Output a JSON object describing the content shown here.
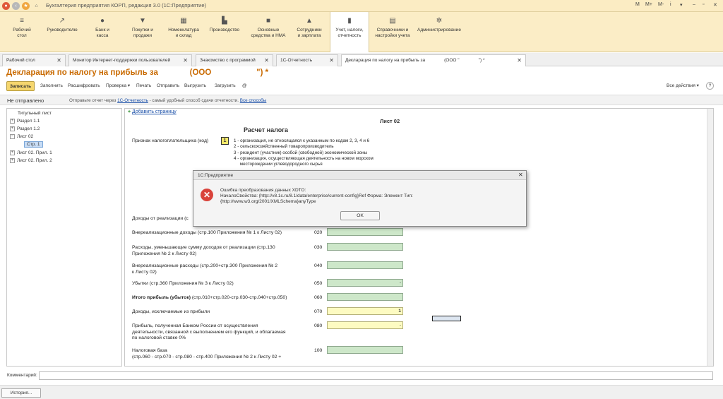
{
  "titlebar": {
    "title": "Бухгалтерия предприятия КОРП, редакция 3.0  (1С:Предприятие)",
    "right_buttons": [
      "M",
      "M+",
      "M-",
      "i"
    ]
  },
  "sections": [
    {
      "label": "Рабочий\nстол",
      "icon": "≡"
    },
    {
      "label": "Руководителю",
      "icon": "↗"
    },
    {
      "label": "Банк и\nкасса",
      "icon": "●"
    },
    {
      "label": "Покупки и\nпродажи",
      "icon": "▼"
    },
    {
      "label": "Номенклатура\nи склад",
      "icon": "▦"
    },
    {
      "label": "Производство",
      "icon": "▙"
    },
    {
      "label": "Основные\nсредства и НМА",
      "icon": "■"
    },
    {
      "label": "Сотрудники\nи зарплата",
      "icon": "▲"
    },
    {
      "label": "Учет, налоги,\nотчетность",
      "icon": "▮"
    },
    {
      "label": "Справочники и\nнастройки учета",
      "icon": "▤"
    },
    {
      "label": "Администрирование",
      "icon": "✲"
    }
  ],
  "tabs": [
    "Рабочий стол",
    "Монитор Интернет-поддержки пользователей",
    "Знакомство с программой",
    "1С-Отчетность",
    "Декларация по налогу на прибыль за               (ООО \"               \") *"
  ],
  "doc": {
    "title": "Декларация по налогу на прибыль за              (ООО                    \") *"
  },
  "toolbar": {
    "save": "Записать",
    "buttons": [
      "Заполнить",
      "Расшифровать",
      "Проверка ▾",
      "Печать",
      "Отправить",
      "Выгрузить",
      "Загрузить",
      "@"
    ],
    "all_actions": "Все действия ▾",
    "help": "?"
  },
  "infobar": {
    "status": "Не отправлено",
    "prefix": "Отправьте отчет через",
    "link1": "1С-Отчетность",
    "middle": "- самый удобный способ сдачи отчетности.",
    "link2": "Все способы"
  },
  "tree": {
    "items": [
      {
        "label": "Титульный лист",
        "exp": ""
      },
      {
        "label": "Раздел 1.1",
        "exp": "+"
      },
      {
        "label": "Раздел 1.2",
        "exp": "+"
      },
      {
        "label": "Лист 02",
        "exp": "−"
      },
      {
        "label": "Стр. 1",
        "exp": ""
      },
      {
        "label": "Лист 02. Прил. 1",
        "exp": "+"
      },
      {
        "label": "Лист 02. Прил. 2",
        "exp": "+"
      }
    ]
  },
  "form": {
    "add_page": "Добавить страницу",
    "sheet": "Лист 02",
    "heading": "Расчет налога",
    "sign_label": "Признак налогоплательщика (код)",
    "sign_value": "1",
    "sign_options": [
      "1 - организация, не относящаяся к указанным по кодам 2, 3, 4 и 6",
      "2 - сельскохозяйственный товаропроизводитель",
      "3 - резидент (участник) особой (свободной) экономической зоны",
      "4 - организация, осуществляющая деятельность на новом морском",
      "     месторождении углеводородного сырья"
    ],
    "rows": [
      {
        "label": "Доходы от реализации (с",
        "code": "",
        "value": ""
      },
      {
        "label": "Внереализационные доходы (стр.100 Приложения № 1 к Листу 02)",
        "code": "020",
        "value": ""
      },
      {
        "label": "Расходы, уменьшающие сумму доходов от реализации (стр.130\nПриложения № 2 к Листу 02)",
        "code": "030",
        "value": ""
      },
      {
        "label": "Внереализационные расходы (стр.200+стр.300 Приложения № 2\nк Листу 02)",
        "code": "040",
        "value": ""
      },
      {
        "label": "Убытки (стр.360 Приложения № 3 к Листу 02)",
        "code": "050",
        "value": "-"
      },
      {
        "label": "Итого прибыль (убыток)",
        "label_rest": "   (стр.010+стр.020-стр.030-стр.040+стр.050)",
        "code": "060",
        "value": ""
      },
      {
        "label": "Доходы, исключаемые из прибыли",
        "code": "070",
        "value": "1"
      },
      {
        "label": "Прибыль, полученная Банком России от осуществления\nдеятельности, связанной с выполнением его функций, и облагаемая\nпо налоговой ставке 0%",
        "code": "080",
        "value": "-"
      },
      {
        "label": "Налоговая база\n(стр.060 - стр.070 - стр.080 - стр.400 Приложения № 2 к Листу 02 +",
        "code": "100",
        "value": ""
      }
    ]
  },
  "dialog": {
    "title": "1С:Предприятие",
    "message": "Ошибка преобразования данных XDTO:\nНачалоСвойства: {http://v8.1c.ru/8.1/data/enterprise/current-config}Ref   Форма: Элемент   Тип:\n{http://www.w3.org/2001/XMLSchema}anyType",
    "ok": "OK",
    "close": "✕"
  },
  "comment": {
    "label": "Комментарий:"
  },
  "status": {
    "history": "История..."
  },
  "colors": {
    "accent": "#c96a00",
    "field_green": "#cde7c9",
    "field_yellow": "#fdfbc2",
    "error": "#d9433b"
  }
}
